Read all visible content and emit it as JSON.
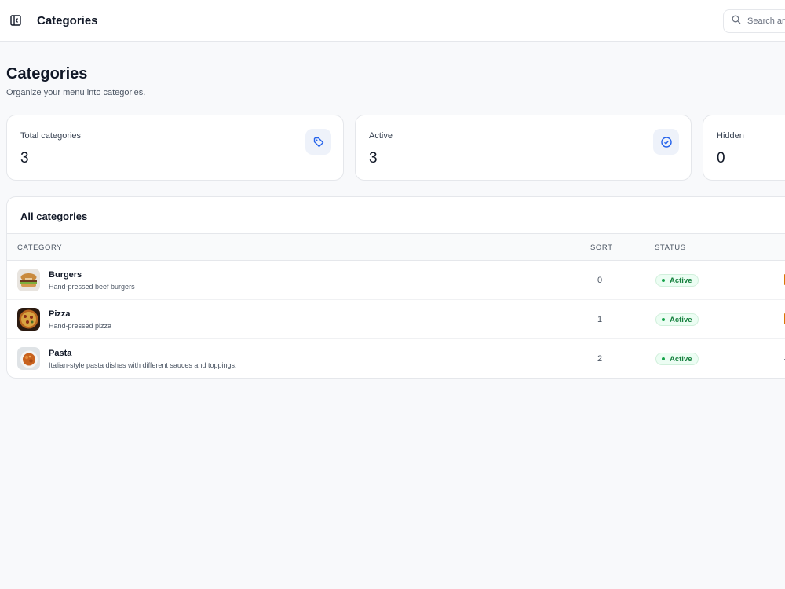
{
  "topbar": {
    "title": "Categories",
    "search_placeholder": "Search anything..."
  },
  "page": {
    "title": "Categories",
    "subtitle": "Organize your menu into categories."
  },
  "stats": [
    {
      "label": "Total categories",
      "value": "3",
      "icon": "tag-icon"
    },
    {
      "label": "Active",
      "value": "3",
      "icon": "check-circle-icon"
    },
    {
      "label": "Hidden",
      "value": "0"
    }
  ],
  "table": {
    "title": "All categories",
    "columns": [
      "CATEGORY",
      "SORT",
      "STATUS"
    ],
    "rows": [
      {
        "name": "Burgers",
        "description": "Hand-pressed beef burgers",
        "sort": "0",
        "status": "Active",
        "thumb": "burger-image"
      },
      {
        "name": "Pizza",
        "description": "Hand-pressed pizza",
        "sort": "1",
        "status": "Active",
        "thumb": "pizza-image"
      },
      {
        "name": "Pasta",
        "description": "Italian-style pasta dishes with different sauces and toppings.",
        "sort": "2",
        "status": "Active",
        "thumb": "pasta-image"
      }
    ]
  },
  "colors": {
    "accent": "#2563eb",
    "icon_bg": "#eef2fa",
    "status_active": "#15803d",
    "status_active_bg": "#ecfdf3",
    "edge_orange": "#d97706"
  }
}
